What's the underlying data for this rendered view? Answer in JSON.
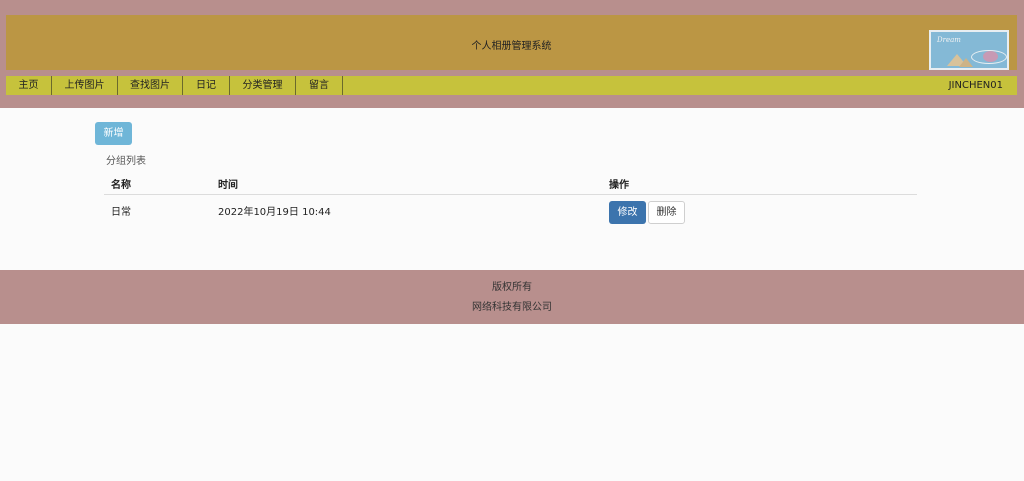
{
  "header": {
    "title": "个人相册管理系统",
    "logo_text": "Dream"
  },
  "nav": {
    "items": [
      "主页",
      "上传图片",
      "查找图片",
      "日记",
      "分类管理",
      "留言"
    ],
    "user": "JINCHEN01"
  },
  "main": {
    "new_button": "新增",
    "section_title": "分组列表",
    "table": {
      "headers": [
        "名称",
        "时间",
        "操作"
      ],
      "rows": [
        {
          "name": "日常",
          "time": "2022年10月19日 10:44",
          "edit": "修改",
          "delete": "删除"
        }
      ]
    }
  },
  "footer": {
    "line1": "版权所有",
    "line2": "网络科技有限公司"
  },
  "colors": {
    "header_band": "#b88f8d",
    "banner": "#bb9644",
    "nav": "#c6c23c",
    "new_button": "#6fb6d8",
    "edit_button": "#3c74ad"
  }
}
